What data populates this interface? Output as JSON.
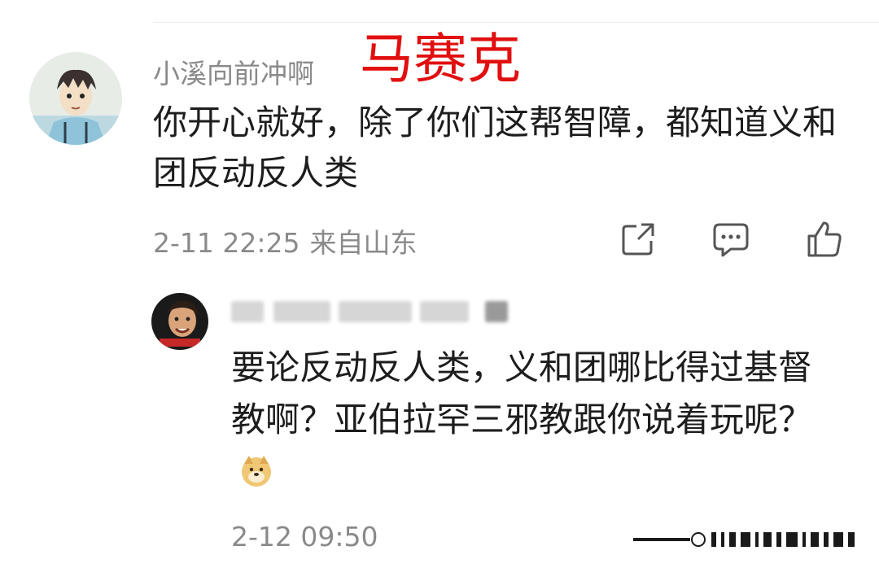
{
  "comment": {
    "username": "小溪向前冲啊",
    "tag": "马赛克",
    "text": "你开心就好，除了你们这帮智障，都知道义和团反动反人类",
    "time": "2-11 22:25",
    "location": "来自山东",
    "actions": [
      "share-icon",
      "reply-icon",
      "like-icon"
    ]
  },
  "reply": {
    "username_blurred": true,
    "text": "要论反动反人类，义和团哪比得过基督教啊？亚伯拉罕三邪教跟你说着玩呢？",
    "emoji": "doge-emoji",
    "time": "2-12 09:50"
  },
  "colors": {
    "tag": "#e10f0f",
    "meta": "#8a8a8a",
    "text": "#1d1d1d"
  }
}
